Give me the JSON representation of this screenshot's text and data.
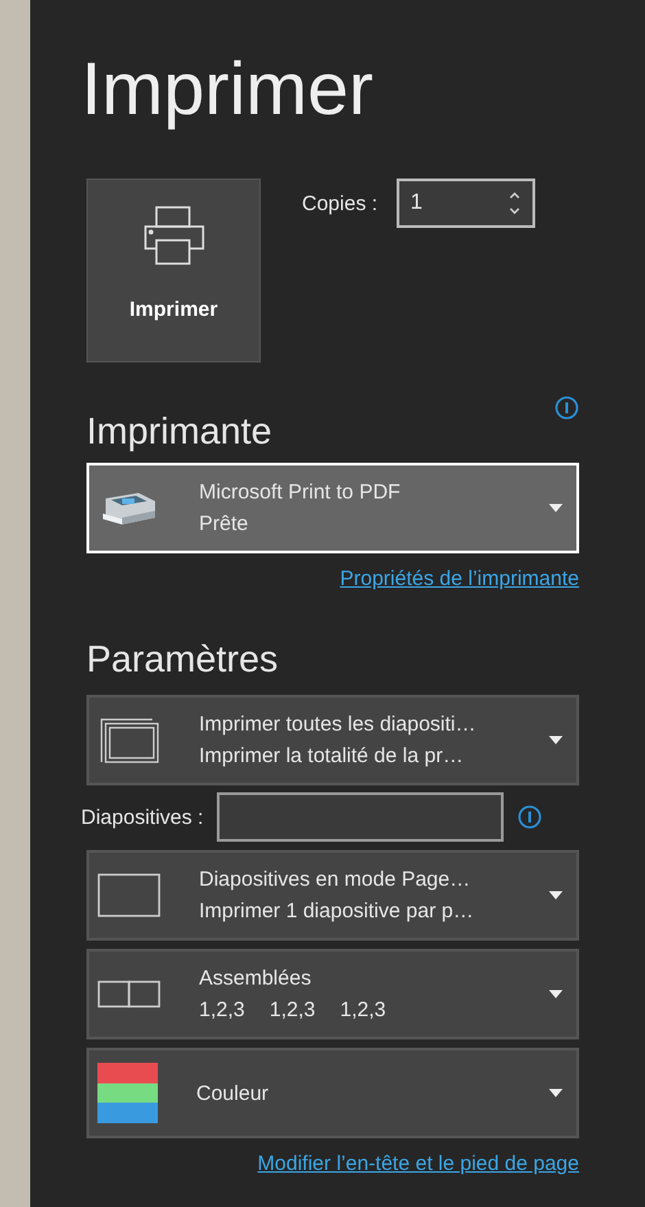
{
  "title": "Imprimer",
  "print_button": {
    "label": "Imprimer"
  },
  "copies": {
    "label": "Copies :",
    "value": "1"
  },
  "printer_section": {
    "heading": "Imprimante",
    "info": true,
    "dropdown": {
      "kind": "printer",
      "focused": true,
      "lines": [
        "Microsoft Print to PDF",
        "Prête"
      ]
    },
    "link": "Propriétés de l’imprimante"
  },
  "settings_section": {
    "heading": "Paramètres",
    "items": [
      {
        "kind": "slides-stack",
        "focused": false,
        "lines": [
          "Imprimer toutes les diapositi…",
          "Imprimer la totalité de la pr…"
        ]
      },
      {
        "kind": "slides-field",
        "label": "Diapositives :",
        "info": true
      },
      {
        "kind": "single-slide",
        "focused": false,
        "lines": [
          "Diapositives en mode Page…",
          "Imprimer 1 diapositive par p…"
        ]
      },
      {
        "kind": "collated",
        "focused": false,
        "lines": [
          "Assemblées"
        ],
        "details": [
          "1,2,3",
          "1,2,3",
          "1,2,3"
        ]
      },
      {
        "kind": "color",
        "focused": false,
        "lines": [
          "Couleur"
        ]
      }
    ],
    "link": "Modifier l’en-tête et le pied de page"
  }
}
